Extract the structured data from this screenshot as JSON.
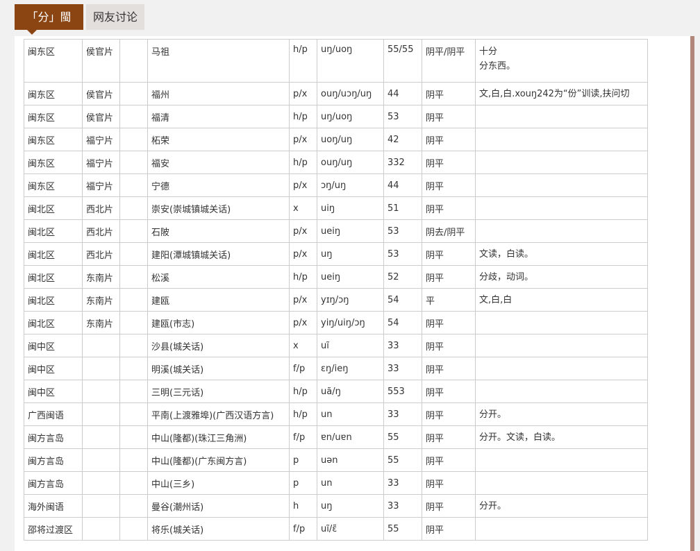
{
  "tabs": [
    {
      "label": "「分」閩語",
      "active": true
    },
    {
      "label": "网友讨论",
      "active": false
    }
  ],
  "colors": {
    "accent": "#8b4513",
    "inactive_tab": "#e3dfdc",
    "border": "#cccccc"
  },
  "table": {
    "rows": [
      {
        "region": "闽东区",
        "sub": "侯官片",
        "blank": "",
        "place": "马祖",
        "initial": "h/p",
        "final": "uŋ/uoŋ",
        "tone": "55/55",
        "tone_class": "阴平/阴平",
        "note": [
          "十分",
          "分东西。"
        ]
      },
      {
        "region": "闽东区",
        "sub": "侯官片",
        "blank": "",
        "place": "福州",
        "initial": "p/x",
        "final": "ouŋ/uɔŋ/uŋ",
        "tone": "44",
        "tone_class": "阴平",
        "note": [
          "文,白,白.xouŋ242为“份”训读,扶问切"
        ]
      },
      {
        "region": "闽东区",
        "sub": "侯官片",
        "blank": "",
        "place": "福清",
        "initial": "h/p",
        "final": "uŋ/uoŋ",
        "tone": "53",
        "tone_class": "阴平",
        "note": []
      },
      {
        "region": "闽东区",
        "sub": "福宁片",
        "blank": "",
        "place": "柘荣",
        "initial": "p/x",
        "final": "uoŋ/uŋ",
        "tone": "42",
        "tone_class": "阴平",
        "note": []
      },
      {
        "region": "闽东区",
        "sub": "福宁片",
        "blank": "",
        "place": "福安",
        "initial": "h/p",
        "final": "ouŋ/uŋ",
        "tone": "332",
        "tone_class": "阴平",
        "note": []
      },
      {
        "region": "闽东区",
        "sub": "福宁片",
        "blank": "",
        "place": "宁德",
        "initial": "p/x",
        "final": "ɔŋ/uŋ",
        "tone": "44",
        "tone_class": "阴平",
        "note": []
      },
      {
        "region": "闽北区",
        "sub": "西北片",
        "blank": "",
        "place": "崇安(崇城镇城关话)",
        "initial": "x",
        "final": "uiŋ",
        "tone": "51",
        "tone_class": "阴平",
        "note": []
      },
      {
        "region": "闽北区",
        "sub": "西北片",
        "blank": "",
        "place": "石陂",
        "initial": "p/x",
        "final": "ueiŋ",
        "tone": "53",
        "tone_class": "阴去/阴平",
        "note": []
      },
      {
        "region": "闽北区",
        "sub": "西北片",
        "blank": "",
        "place": "建阳(潭城镇城关话)",
        "initial": "p/x",
        "final": "uŋ",
        "tone": "53",
        "tone_class": "阴平",
        "note": [
          "文读，白读。"
        ]
      },
      {
        "region": "闽北区",
        "sub": "东南片",
        "blank": "",
        "place": "松溪",
        "initial": "h/p",
        "final": "ueiŋ",
        "tone": "52",
        "tone_class": "阴平",
        "note": [
          "分歧，动词。"
        ]
      },
      {
        "region": "闽北区",
        "sub": "东南片",
        "blank": "",
        "place": "建瓯",
        "initial": "p/x",
        "final": "yɪŋ/ɔŋ",
        "tone": "54",
        "tone_class": "平",
        "note": [
          "文,白,白"
        ]
      },
      {
        "region": "闽北区",
        "sub": "东南片",
        "blank": "",
        "place": "建瓯(市志)",
        "initial": "p/x",
        "final": "yiŋ/uiŋ/ɔŋ",
        "tone": "54",
        "tone_class": "阴平",
        "note": []
      },
      {
        "region": "闽中区",
        "sub": "",
        "blank": "",
        "place": "沙县(城关话)",
        "initial": "x",
        "final": "uĩ",
        "tone": "33",
        "tone_class": "阴平",
        "note": []
      },
      {
        "region": "闽中区",
        "sub": "",
        "blank": "",
        "place": "明溪(城关话)",
        "initial": "f/p",
        "final": "ɛŋ/ieŋ",
        "tone": "33",
        "tone_class": "阴平",
        "note": []
      },
      {
        "region": "闽中区",
        "sub": "",
        "blank": "",
        "place": "三明(三元话)",
        "initial": "h/p",
        "final": "uã/ŋ",
        "tone": "553",
        "tone_class": "阴平",
        "note": []
      },
      {
        "region": "广西闽语",
        "sub": "",
        "blank": "",
        "place": "平南(上渡雅埠)(广西汉语方言)",
        "initial": "h/p",
        "final": "un",
        "tone": "33",
        "tone_class": "阴平",
        "note": [
          "分开。"
        ]
      },
      {
        "region": "闽方言岛",
        "sub": "",
        "blank": "",
        "place": "中山(隆都)(珠江三角洲)",
        "initial": "f/p",
        "final": "ɐn/uɐn",
        "tone": "55",
        "tone_class": "阴平",
        "note": [
          "分开。文读，白读。"
        ]
      },
      {
        "region": "闽方言岛",
        "sub": "",
        "blank": "",
        "place": "中山(隆都)(广东闽方言)",
        "initial": "p",
        "final": "uən",
        "tone": "55",
        "tone_class": "阴平",
        "note": []
      },
      {
        "region": "闽方言岛",
        "sub": "",
        "blank": "",
        "place": "中山(三乡)",
        "initial": "p",
        "final": "un",
        "tone": "33",
        "tone_class": "阴平",
        "note": []
      },
      {
        "region": "海外闽语",
        "sub": "",
        "blank": "",
        "place": "曼谷(潮州话)",
        "initial": "h",
        "final": "uŋ",
        "tone": "33",
        "tone_class": "阴平",
        "note": [
          "分开。"
        ]
      },
      {
        "region": "邵将过渡区",
        "sub": "",
        "blank": "",
        "place": "将乐(城关话)",
        "initial": "f/p",
        "final": "uĩ/ɛ̃",
        "tone": "55",
        "tone_class": "阴平",
        "note": []
      }
    ]
  }
}
